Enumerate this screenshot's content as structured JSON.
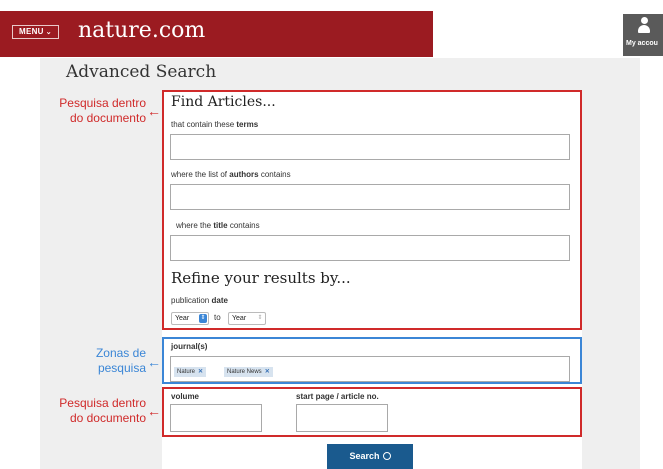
{
  "header": {
    "menu_label": "MENU",
    "menu_chevron": "⌄",
    "logo": "nature.com",
    "account_label": "My accou",
    "brand_color": "#9b1b21"
  },
  "page": {
    "title": "Advanced Search"
  },
  "find_articles": {
    "title": "Find Articles...",
    "terms_label_pre": "that contain these ",
    "terms_label_bold": "terms",
    "terms_value": "",
    "authors_label_pre": "where the list of ",
    "authors_label_bold": "authors",
    "authors_label_post": " contains",
    "authors_value": "",
    "title_label_pre": "where the ",
    "title_label_bold": "title",
    "title_label_post": " contains",
    "title_value": ""
  },
  "refine": {
    "title": "Refine your results by...",
    "date_label_pre": "publication ",
    "date_label_bold": "date",
    "from_year": "Year",
    "to_label": "to",
    "to_year": "Year"
  },
  "journals": {
    "label": "journal(s)",
    "tags": [
      {
        "label": "Nature",
        "remove": "✕"
      },
      {
        "label": "Nature News",
        "remove": "✕"
      }
    ]
  },
  "volume": {
    "label": "volume",
    "value": ""
  },
  "start_page": {
    "label": "start page / article no.",
    "value": ""
  },
  "search_button": {
    "label": "Search"
  },
  "annotations": {
    "box1": {
      "line1": "Pesquisa dentro",
      "line2": "do documento",
      "arrow": "←"
    },
    "box2": {
      "line1": "Zonas de",
      "line2": "pesquisa",
      "arrow": "←"
    },
    "box3": {
      "line1": "Pesquisa dentro",
      "line2": "do documento",
      "arrow": "←"
    },
    "red_color": "#d02a2a",
    "blue_color": "#3b86d6"
  }
}
